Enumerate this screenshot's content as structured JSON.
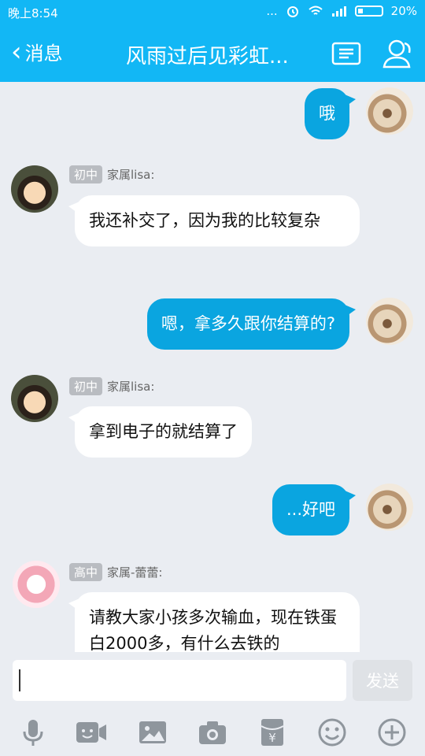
{
  "status": {
    "time": "晚上8:54",
    "dots": "...",
    "battery": "20%"
  },
  "header": {
    "back_label": "消息",
    "title": "风雨过后见彩虹..."
  },
  "messages": [
    {
      "dir": "out",
      "text": "哦"
    },
    {
      "dir": "in",
      "badge": "初中",
      "sender": "家属lisa:",
      "text": "我还补交了，因为我的比较复杂"
    },
    {
      "dir": "out",
      "text": "嗯，拿多久跟你结算的?"
    },
    {
      "dir": "in",
      "badge": "初中",
      "sender": "家属lisa:",
      "text": "拿到电子的就结算了"
    },
    {
      "dir": "out",
      "text": "...好吧"
    },
    {
      "dir": "in",
      "badge": "高中",
      "sender": "家属-蕾蕾:",
      "text": "请教大家小孩多次输血，现在铁蛋白2000多，有什么去铁的"
    }
  ],
  "input": {
    "send_label": "发送"
  },
  "toolbar": [
    "mic-icon",
    "video-icon",
    "image-icon",
    "camera-icon",
    "red-packet-icon",
    "emoji-icon",
    "plus-icon"
  ],
  "colors": {
    "primary": "#12b7f5",
    "bubble_out": "#0aa5e0",
    "bubble_in": "#ffffff",
    "background": "#eaedf2"
  }
}
